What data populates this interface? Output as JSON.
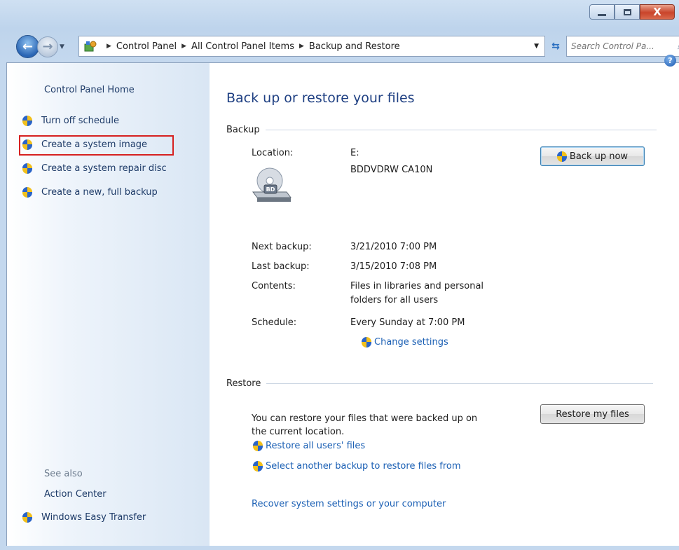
{
  "window": {
    "caption_buttons": {
      "close": "X"
    }
  },
  "nav": {
    "breadcrumbs": [
      "Control Panel",
      "All Control Panel Items",
      "Backup and Restore"
    ],
    "search_placeholder": "Search Control Pa..."
  },
  "left_pane": {
    "home": "Control Panel Home",
    "tasks": [
      {
        "label": "Turn off schedule"
      },
      {
        "label": "Create a system image",
        "highlighted": true
      },
      {
        "label": "Create a system repair disc"
      },
      {
        "label": "Create a new, full backup"
      }
    ],
    "see_also_label": "See also",
    "see_also": [
      "Action Center",
      "Windows Easy Transfer"
    ]
  },
  "main": {
    "title": "Back up or restore your files",
    "backup": {
      "heading": "Backup",
      "location_label": "Location:",
      "location_value": "E:",
      "device_name": "BDDVDRW CA10N",
      "drive_badge": "BD",
      "back_up_now": "Back up now",
      "next_backup_label": "Next backup:",
      "next_backup_value": "3/21/2010 7:00 PM",
      "last_backup_label": "Last backup:",
      "last_backup_value": "3/15/2010 7:08 PM",
      "contents_label": "Contents:",
      "contents_value_1": "Files in libraries and personal",
      "contents_value_2": "folders for all users",
      "schedule_label": "Schedule:",
      "schedule_value": "Every Sunday at 7:00 PM",
      "change_settings": "Change settings"
    },
    "restore": {
      "heading": "Restore",
      "description_1": "You can restore your files that were backed up on",
      "description_2": "the current location.",
      "restore_my_files": "Restore my files",
      "restore_all_users": "Restore all users' files",
      "select_another": "Select another backup to restore files from",
      "recover_system": "Recover system settings or your computer"
    }
  }
}
